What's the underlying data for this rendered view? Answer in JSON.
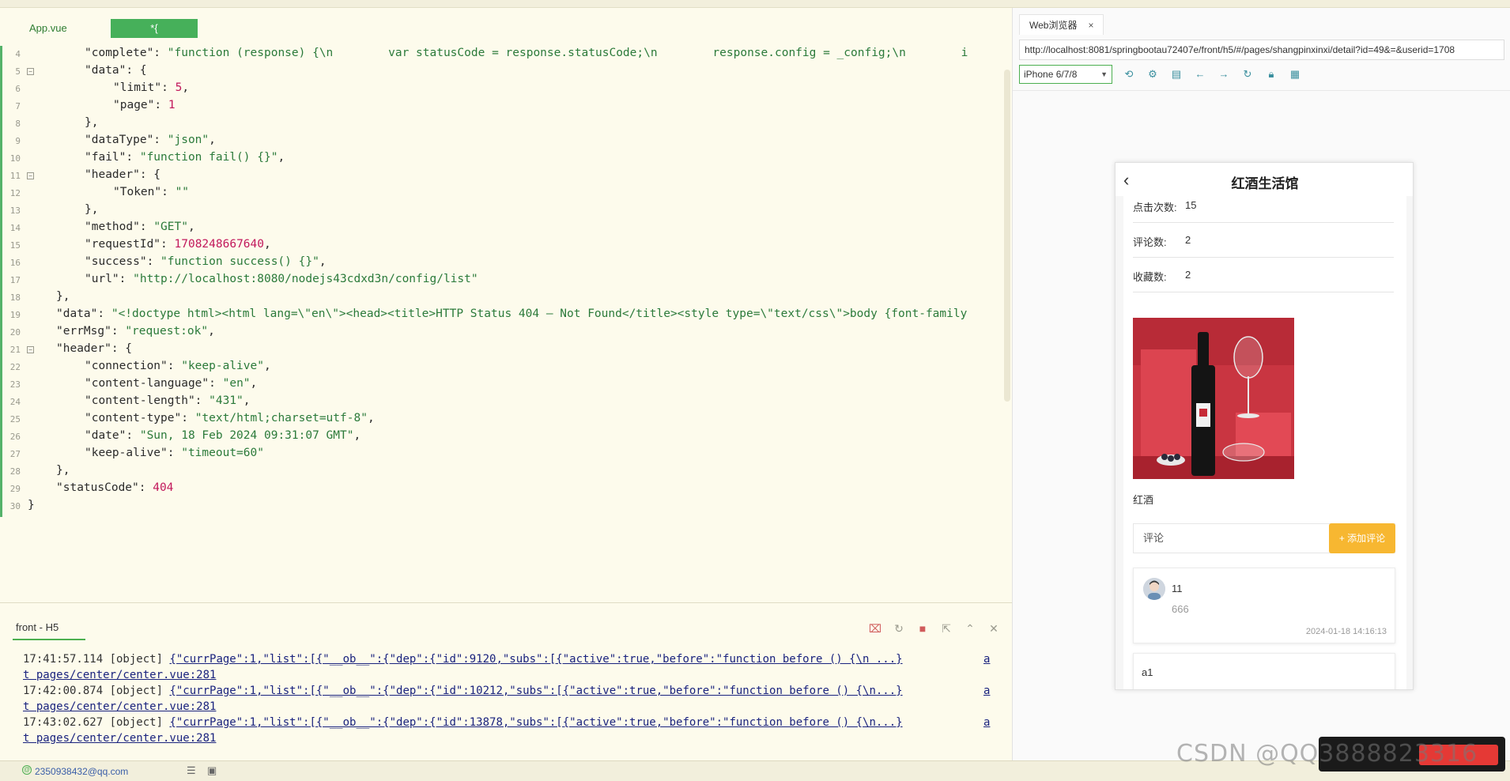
{
  "editor": {
    "tabs": [
      "App.vue",
      "*{"
    ],
    "lines": [
      {
        "n": "4",
        "fold": false,
        "indent": 2,
        "html": "\"complete\": <s>\"function (response) {\\n        var statusCode = response.statusCode;\\n        response.config = _config;\\n        i</s>"
      },
      {
        "n": "5",
        "fold": true,
        "indent": 2,
        "html": "\"data\": {"
      },
      {
        "n": "6",
        "fold": false,
        "indent": 3,
        "html": "\"limit\": <n>5</n>,"
      },
      {
        "n": "7",
        "fold": false,
        "indent": 3,
        "html": "\"page\": <n>1</n>"
      },
      {
        "n": "8",
        "fold": false,
        "indent": 2,
        "html": "},"
      },
      {
        "n": "9",
        "fold": false,
        "indent": 2,
        "html": "\"dataType\": <s>\"json\"</s>,"
      },
      {
        "n": "10",
        "fold": false,
        "indent": 2,
        "html": "\"fail\": <s>\"function fail() {}\"</s>,"
      },
      {
        "n": "11",
        "fold": true,
        "indent": 2,
        "html": "\"header\": {"
      },
      {
        "n": "12",
        "fold": false,
        "indent": 3,
        "html": "\"Token\": <s>\"\"</s>"
      },
      {
        "n": "13",
        "fold": false,
        "indent": 2,
        "html": "},"
      },
      {
        "n": "14",
        "fold": false,
        "indent": 2,
        "html": "\"method\": <s>\"GET\"</s>,"
      },
      {
        "n": "15",
        "fold": false,
        "indent": 2,
        "html": "\"requestId\": <n>1708248667640</n>,"
      },
      {
        "n": "16",
        "fold": false,
        "indent": 2,
        "html": "\"success\": <s>\"function success() {}\"</s>,"
      },
      {
        "n": "17",
        "fold": false,
        "indent": 2,
        "html": "\"url\": <s>\"http://localhost:8080/nodejs43cdxd3n/config/list\"</s>"
      },
      {
        "n": "18",
        "fold": false,
        "indent": 1,
        "html": "},"
      },
      {
        "n": "19",
        "fold": false,
        "indent": 1,
        "html": "\"data\": <s>\"&lt;!doctype html&gt;&lt;html lang=\\\"en\\\"&gt;&lt;head&gt;&lt;title&gt;HTTP Status 404 – Not Found&lt;/title&gt;&lt;style type=\\\"text/css\\\"&gt;body {font-family</s>"
      },
      {
        "n": "20",
        "fold": false,
        "indent": 1,
        "html": "\"errMsg\": <s>\"request:ok\"</s>,"
      },
      {
        "n": "21",
        "fold": true,
        "indent": 1,
        "html": "\"header\": {"
      },
      {
        "n": "22",
        "fold": false,
        "indent": 2,
        "html": "\"connection\": <s>\"keep-alive\"</s>,"
      },
      {
        "n": "23",
        "fold": false,
        "indent": 2,
        "html": "\"content-language\": <s>\"en\"</s>,"
      },
      {
        "n": "24",
        "fold": false,
        "indent": 2,
        "html": "\"content-length\": <s>\"431\"</s>,"
      },
      {
        "n": "25",
        "fold": false,
        "indent": 2,
        "html": "\"content-type\": <s>\"text/html;charset=utf-8\"</s>,"
      },
      {
        "n": "26",
        "fold": false,
        "indent": 2,
        "html": "\"date\": <s>\"Sun, 18 Feb 2024 09:31:07 GMT\"</s>,"
      },
      {
        "n": "27",
        "fold": false,
        "indent": 2,
        "html": "\"keep-alive\": <s>\"timeout=60\"</s>"
      },
      {
        "n": "28",
        "fold": false,
        "indent": 1,
        "html": "},"
      },
      {
        "n": "29",
        "fold": false,
        "indent": 1,
        "html": "\"statusCode\": <n>404</n>"
      },
      {
        "n": "30",
        "fold": false,
        "indent": 0,
        "html": "}"
      }
    ]
  },
  "console": {
    "tab": "front - H5",
    "logs": [
      {
        "time": "17:41:57.114",
        "type": "[object]",
        "msg": "{\"currPage\":1,\"list\":[{\"__ob__\":{\"dep\":{\"id\":9120,\"subs\":[{\"active\":true,\"before\":\"function before () {\\n ...}",
        "link": "a",
        "src": "t pages/center/center.vue:281"
      },
      {
        "time": "17:42:00.874",
        "type": "[object]",
        "msg": "{\"currPage\":1,\"list\":[{\"__ob__\":{\"dep\":{\"id\":10212,\"subs\":[{\"active\":true,\"before\":\"function before () {\\n...}",
        "link": "a",
        "src": "t pages/center/center.vue:281"
      },
      {
        "time": "17:43:02.627",
        "type": "[object]",
        "msg": "{\"currPage\":1,\"list\":[{\"__ob__\":{\"dep\":{\"id\":13878,\"subs\":[{\"active\":true,\"before\":\"function before () {\\n...}",
        "link": "a",
        "src": "t pages/center/center.vue:281"
      }
    ]
  },
  "statusbar": {
    "email": "2350938432@qq.com"
  },
  "browser": {
    "tab_label": "Web浏览器",
    "tab_close": "×",
    "url": "http://localhost:8081/springbootau72407e/front/h5/#/pages/shangpinxinxi/detail?id=49&=&userid=1708",
    "device": "iPhone 6/7/8"
  },
  "phone": {
    "title": "红酒生活馆",
    "stats": [
      {
        "label": "点击次数:",
        "value": "15"
      },
      {
        "label": "评论数:",
        "value": "2"
      },
      {
        "label": "收藏数:",
        "value": "2"
      }
    ],
    "product_name": "红酒",
    "comment_placeholder": "评论",
    "add_comment": "+ 添加评论",
    "comments": [
      {
        "user": "11",
        "text": "666",
        "time": "2024-01-18 14:16:13"
      },
      {
        "user": "a1",
        "text": "",
        "time": ""
      }
    ]
  },
  "watermark": "CSDN @QQ3888823316"
}
